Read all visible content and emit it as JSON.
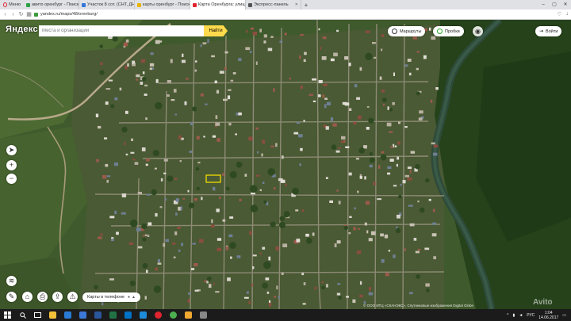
{
  "browser": {
    "menu_label": "Меню",
    "tabs": [
      {
        "title": "авито оренбург - Поиск",
        "color": "#2fa045",
        "active": false
      },
      {
        "title": "Участок 8 сот. (СНТ, ДНП)",
        "color": "#3377dd",
        "active": false
      },
      {
        "title": "карты оренбург - Поиск",
        "color": "#e8b400",
        "active": false
      },
      {
        "title": "Карта Оренбурга: улицы",
        "color": "#e0242f",
        "active": true
      },
      {
        "title": "Экспресс-панель",
        "color": "#555555",
        "active": false
      }
    ],
    "url": "yandex.ru/maps/48/orenburg/"
  },
  "map": {
    "logo": "Яндекс",
    "search_placeholder": "Места и организации",
    "search_button": "Найти",
    "routes_label": "Маршруты",
    "traffic_label": "Пробки",
    "login_label": "Войти",
    "phone_label": "Карты в телефоне",
    "copyright": "© ООО ИТЦ «СКАНЭКС», Спутниковые изображения Digital Globe",
    "watermark": "Avito"
  },
  "taskbar": {
    "apps": [
      {
        "name": "file-explorer-icon",
        "color": "#f3c13a"
      },
      {
        "name": "edge-icon",
        "color": "#2a7bd4"
      },
      {
        "name": "store-icon",
        "color": "#3c78d8"
      },
      {
        "name": "word-icon",
        "color": "#2b579a"
      },
      {
        "name": "excel-icon",
        "color": "#217346"
      },
      {
        "name": "outlook-icon",
        "color": "#0072c6"
      },
      {
        "name": "app-blue-icon",
        "color": "#1e8bd8"
      },
      {
        "name": "opera-icon",
        "color": "#e0242f"
      },
      {
        "name": "chrome-icon",
        "color": "#4caf50"
      },
      {
        "name": "explorer-icon",
        "color": "#f0a830"
      },
      {
        "name": "app-grey-icon",
        "color": "#888888"
      }
    ],
    "language": "РУС",
    "time": "1:04",
    "date": "14.06.2017"
  }
}
